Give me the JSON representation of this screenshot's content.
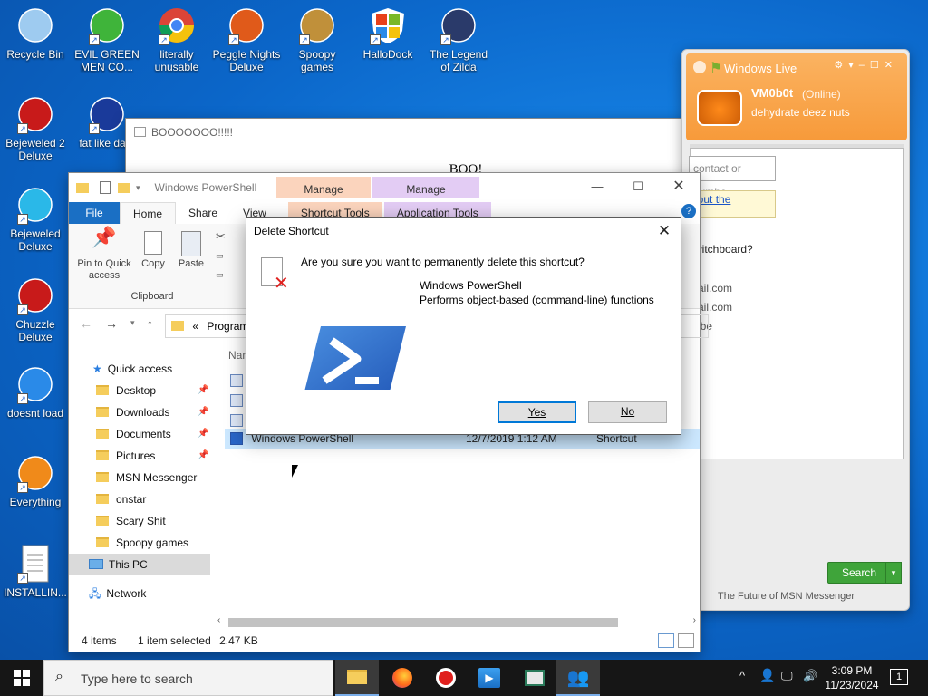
{
  "desktop_icons": [
    {
      "name": "recycle-bin",
      "label": "Recycle Bin",
      "col": 0,
      "row": 0
    },
    {
      "name": "evil-green-men",
      "label": "EVIL GREEN MEN CO...",
      "col": 1,
      "row": 0
    },
    {
      "name": "chrome",
      "label": "literally unusable",
      "col": 2,
      "row": 0
    },
    {
      "name": "peggle",
      "label": "Peggle Nights Deluxe",
      "col": 3,
      "row": 0
    },
    {
      "name": "spoopy",
      "label": "Spoopy games",
      "col": 4,
      "row": 0
    },
    {
      "name": "hallodock",
      "label": "HalloDock",
      "col": 5,
      "row": 0
    },
    {
      "name": "zilda",
      "label": "The Legend of Zilda",
      "col": 6,
      "row": 0
    },
    {
      "name": "bejeweled2",
      "label": "Bejeweled 2 Deluxe",
      "col": 0,
      "row": 1
    },
    {
      "name": "mpl",
      "label": "fat like dark",
      "col": 1,
      "row": 1
    },
    {
      "name": "bejeweled",
      "label": "Bejeweled Deluxe",
      "col": 0,
      "row": 2
    },
    {
      "name": "chuzzle",
      "label": "Chuzzle Deluxe",
      "col": 0,
      "row": 3
    },
    {
      "name": "thunderbird",
      "label": "doesnt load",
      "col": 0,
      "row": 4
    },
    {
      "name": "everything",
      "label": "Everything",
      "col": 0,
      "row": 5
    },
    {
      "name": "installing",
      "label": "INSTALLIN...",
      "col": 0,
      "row": 6
    }
  ],
  "boo_window": {
    "title": "BOOOOOOO!!!!!",
    "content": "BOO!"
  },
  "explorer": {
    "title": "Windows PowerShell",
    "context_tabs": [
      {
        "group": "Manage",
        "tab": "Shortcut Tools",
        "color": "#fbd4bd"
      },
      {
        "group": "Manage",
        "tab": "Application Tools",
        "color": "#e3ccf4"
      }
    ],
    "tabs": [
      "File",
      "Home",
      "Share",
      "View"
    ],
    "ribbon": {
      "pin": "Pin to Quick access",
      "copy": "Copy",
      "paste": "Paste",
      "group": "Clipboard"
    },
    "address": "Programs",
    "address_prefix": "«",
    "column_name": "Nam",
    "nav": {
      "quick_access": "Quick access",
      "items": [
        {
          "label": "Desktop",
          "pinned": true
        },
        {
          "label": "Downloads",
          "pinned": true
        },
        {
          "label": "Documents",
          "pinned": true
        },
        {
          "label": "Pictures",
          "pinned": true
        },
        {
          "label": "MSN Messenger",
          "pinned": false
        },
        {
          "label": "onstar",
          "pinned": false
        },
        {
          "label": "Scary Shit",
          "pinned": false
        },
        {
          "label": "Spoopy games",
          "pinned": false
        }
      ],
      "this_pc": "This PC",
      "network": "Network"
    },
    "file": {
      "name": "Windows PowerShell",
      "date": "12/7/2019 1:12 AM",
      "type": "Shortcut"
    },
    "status": {
      "items": "4 items",
      "selected": "1 item selected",
      "size": "2.47 KB"
    }
  },
  "messenger": {
    "title": "Windows Live",
    "user": "VM0b0t",
    "presence": "(Online)",
    "status_msg": "dehydrate deez nuts",
    "search_placeholder": "contact or numbe",
    "link": "bout the",
    "link2": "e",
    "question": "switchboard?",
    "contacts": [
      "mail.com",
      "mail.com",
      "cube"
    ],
    "search_btn": "Search",
    "footer": "The Future of MSN Messenger"
  },
  "dialog": {
    "title": "Delete Shortcut",
    "question": "Are you sure you want to permanently delete this shortcut?",
    "app_name": "Windows PowerShell",
    "app_desc": "Performs object-based (command-line) functions",
    "yes": "Yes",
    "no": "No"
  },
  "taskbar": {
    "search_placeholder": "Type here to search",
    "time": "3:09 PM",
    "date": "11/23/2024",
    "notification_count": "1"
  }
}
